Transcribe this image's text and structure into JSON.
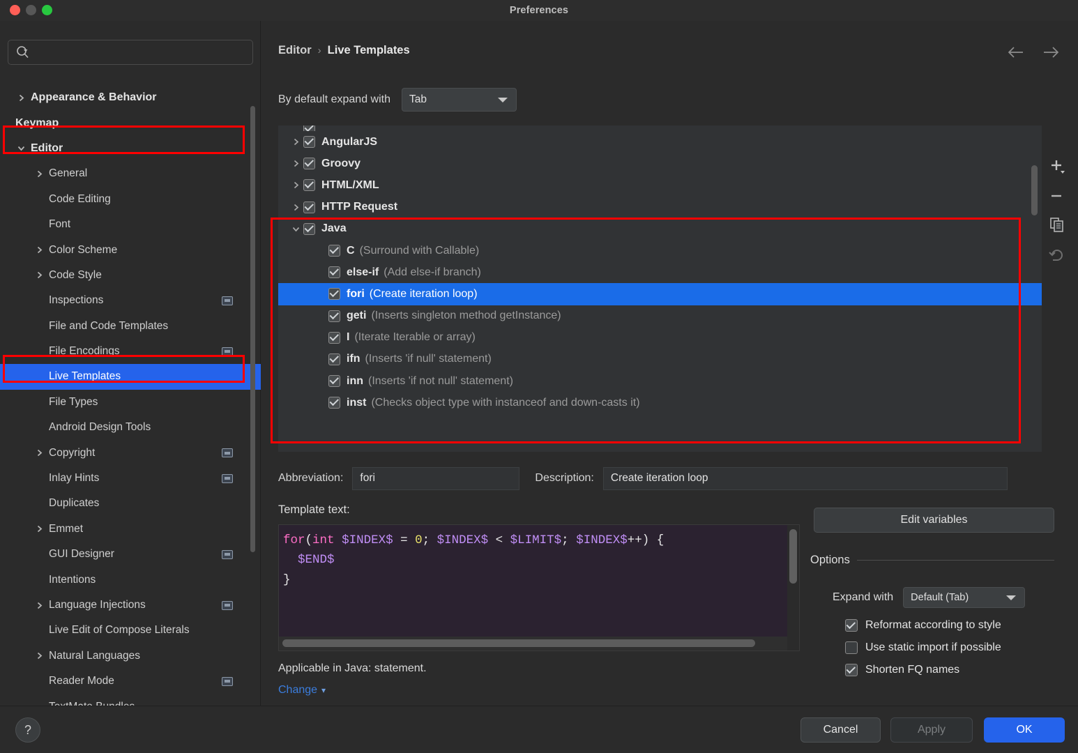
{
  "window": {
    "title": "Preferences"
  },
  "search": {
    "value": "",
    "placeholder": ""
  },
  "sidebar": {
    "items": [
      {
        "label": "Appearance & Behavior",
        "level": 0,
        "arrow": true,
        "bold": true,
        "badge": false,
        "selected": false
      },
      {
        "label": "Keymap",
        "level": 0,
        "arrow": false,
        "bold": true,
        "badge": false,
        "selected": false
      },
      {
        "label": "Editor",
        "level": 0,
        "arrow": true,
        "bold": true,
        "badge": false,
        "selected": false,
        "expanded": true
      },
      {
        "label": "General",
        "level": 1,
        "arrow": true,
        "bold": false,
        "badge": false,
        "selected": false
      },
      {
        "label": "Code Editing",
        "level": 1,
        "arrow": false,
        "bold": false,
        "badge": false,
        "selected": false
      },
      {
        "label": "Font",
        "level": 1,
        "arrow": false,
        "bold": false,
        "badge": false,
        "selected": false
      },
      {
        "label": "Color Scheme",
        "level": 1,
        "arrow": true,
        "bold": false,
        "badge": false,
        "selected": false
      },
      {
        "label": "Code Style",
        "level": 1,
        "arrow": true,
        "bold": false,
        "badge": false,
        "selected": false
      },
      {
        "label": "Inspections",
        "level": 1,
        "arrow": false,
        "bold": false,
        "badge": true,
        "selected": false
      },
      {
        "label": "File and Code Templates",
        "level": 1,
        "arrow": false,
        "bold": false,
        "badge": false,
        "selected": false
      },
      {
        "label": "File Encodings",
        "level": 1,
        "arrow": false,
        "bold": false,
        "badge": true,
        "selected": false
      },
      {
        "label": "Live Templates",
        "level": 1,
        "arrow": false,
        "bold": false,
        "badge": false,
        "selected": true
      },
      {
        "label": "File Types",
        "level": 1,
        "arrow": false,
        "bold": false,
        "badge": false,
        "selected": false
      },
      {
        "label": "Android Design Tools",
        "level": 1,
        "arrow": false,
        "bold": false,
        "badge": false,
        "selected": false
      },
      {
        "label": "Copyright",
        "level": 1,
        "arrow": true,
        "bold": false,
        "badge": true,
        "selected": false
      },
      {
        "label": "Inlay Hints",
        "level": 1,
        "arrow": false,
        "bold": false,
        "badge": true,
        "selected": false
      },
      {
        "label": "Duplicates",
        "level": 1,
        "arrow": false,
        "bold": false,
        "badge": false,
        "selected": false
      },
      {
        "label": "Emmet",
        "level": 1,
        "arrow": true,
        "bold": false,
        "badge": false,
        "selected": false
      },
      {
        "label": "GUI Designer",
        "level": 1,
        "arrow": false,
        "bold": false,
        "badge": true,
        "selected": false
      },
      {
        "label": "Intentions",
        "level": 1,
        "arrow": false,
        "bold": false,
        "badge": false,
        "selected": false
      },
      {
        "label": "Language Injections",
        "level": 1,
        "arrow": true,
        "bold": false,
        "badge": true,
        "selected": false
      },
      {
        "label": "Live Edit of Compose Literals",
        "level": 1,
        "arrow": false,
        "bold": false,
        "badge": false,
        "selected": false
      },
      {
        "label": "Natural Languages",
        "level": 1,
        "arrow": true,
        "bold": false,
        "badge": false,
        "selected": false
      },
      {
        "label": "Reader Mode",
        "level": 1,
        "arrow": false,
        "bold": false,
        "badge": true,
        "selected": false
      },
      {
        "label": "TextMate Bundles",
        "level": 1,
        "arrow": false,
        "bold": false,
        "badge": false,
        "selected": false
      }
    ]
  },
  "main": {
    "breadcrumb": {
      "root": "Editor",
      "separator": "›",
      "leaf": "Live Templates"
    },
    "nav": {
      "back": "←",
      "forward": "→"
    },
    "expand_default": {
      "label": "By default expand with",
      "value": "Tab"
    },
    "tree": {
      "groups": [
        {
          "name": "AngularJS",
          "checked": true,
          "expanded": false
        },
        {
          "name": "Groovy",
          "checked": true,
          "expanded": false
        },
        {
          "name": "HTML/XML",
          "checked": true,
          "expanded": false
        },
        {
          "name": "HTTP Request",
          "checked": true,
          "expanded": false
        },
        {
          "name": "Java",
          "checked": true,
          "expanded": true
        }
      ],
      "java_templates": [
        {
          "abbr": "C",
          "desc": "(Surround with Callable)",
          "checked": true,
          "selected": false
        },
        {
          "abbr": "else-if",
          "desc": "(Add else-if branch)",
          "checked": true,
          "selected": false
        },
        {
          "abbr": "fori",
          "desc": "(Create iteration loop)",
          "checked": true,
          "selected": true
        },
        {
          "abbr": "geti",
          "desc": "(Inserts singleton method getInstance)",
          "checked": true,
          "selected": false
        },
        {
          "abbr": "I",
          "desc": "(Iterate Iterable or array)",
          "checked": true,
          "selected": false
        },
        {
          "abbr": "ifn",
          "desc": "(Inserts 'if null' statement)",
          "checked": true,
          "selected": false
        },
        {
          "abbr": "inn",
          "desc": "(Inserts 'if not null' statement)",
          "checked": true,
          "selected": false
        },
        {
          "abbr": "inst",
          "desc": "(Checks object type with instanceof and down-casts it)",
          "checked": true,
          "selected": false
        }
      ]
    },
    "toolbar": {
      "add": "add-template-button",
      "remove": "remove-template-button",
      "duplicate": "duplicate-template-button",
      "revert": "revert-template-button"
    },
    "fields": {
      "abbreviation_label": "Abbreviation:",
      "abbreviation_value": "fori",
      "description_label": "Description:",
      "description_value": "Create iteration loop"
    },
    "template_text": {
      "label": "Template text:",
      "lines": [
        "for(int $INDEX$ = 0; $INDEX$ < $LIMIT$; $INDEX$++) {",
        "  $END$",
        "}"
      ]
    },
    "edit_variables_label": "Edit variables",
    "options": {
      "title": "Options",
      "expand_with_label": "Expand with",
      "expand_with_value": "Default (Tab)",
      "checkboxes": [
        {
          "label": "Reformat according to style",
          "checked": true
        },
        {
          "label": "Use static import if possible",
          "checked": false
        },
        {
          "label": "Shorten FQ names",
          "checked": true
        }
      ]
    },
    "applicable": "Applicable in Java: statement.",
    "change_link": "Change"
  },
  "footer": {
    "help": "?",
    "cancel": "Cancel",
    "apply": "Apply",
    "ok": "OK"
  },
  "colors": {
    "accent": "#2563eb",
    "highlight_box": "#ff0000",
    "selection": "#1a6ce8",
    "keyword": "#ff6ec7",
    "variable": "#c08ef5",
    "number": "#e8e06a",
    "link": "#3b7ddd"
  }
}
